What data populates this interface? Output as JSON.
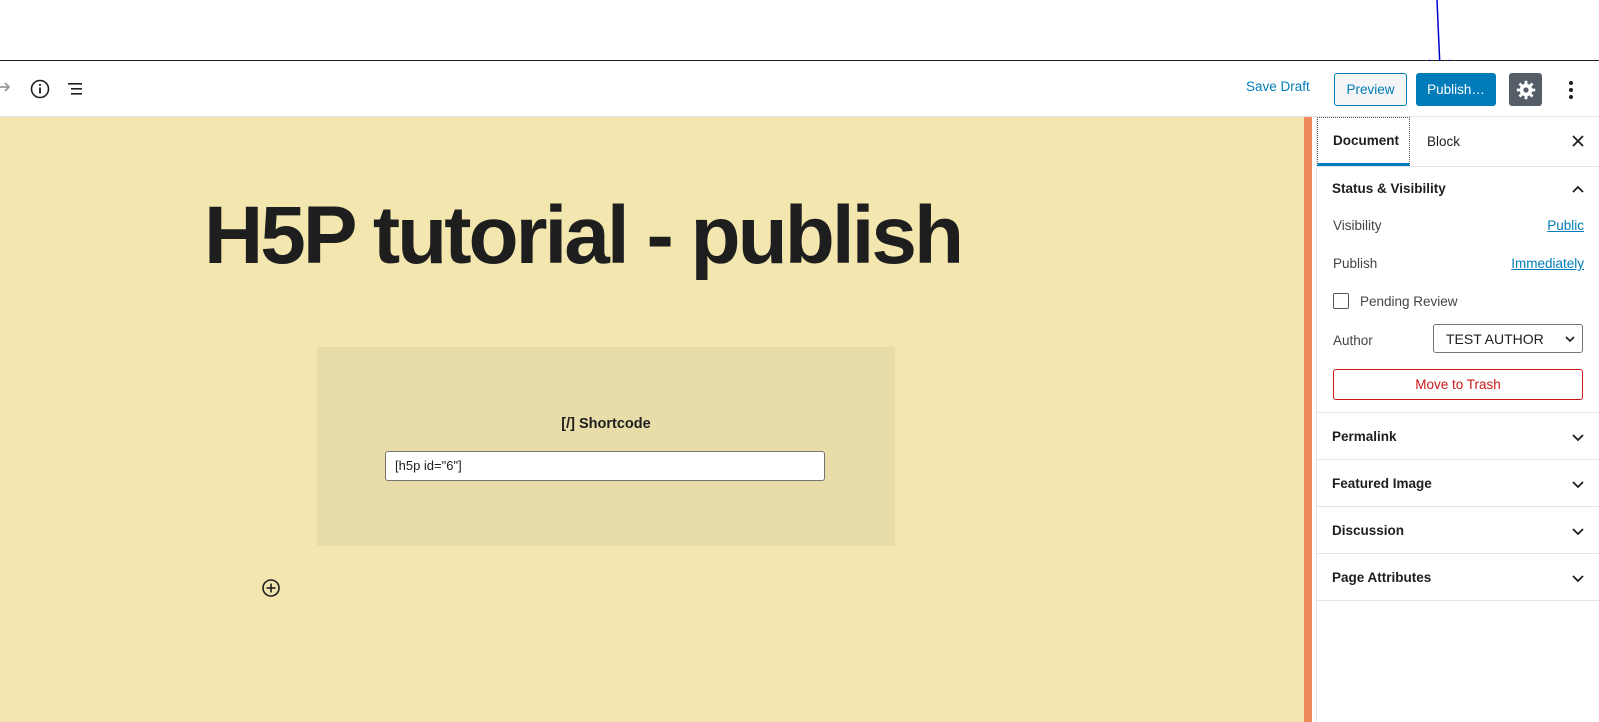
{
  "toolbar": {
    "save_draft": "Save Draft",
    "preview": "Preview",
    "publish": "Publish…",
    "icons": [
      "redo-icon",
      "info-icon",
      "list-view-icon",
      "gear-icon",
      "more-vertical-icon"
    ]
  },
  "editor": {
    "title": "H5P tutorial - publish",
    "shortcode_label": "[/]  Shortcode",
    "shortcode_value": "[h5p id=\"6\"]"
  },
  "sidebar": {
    "tabs": [
      "Document",
      "Block"
    ],
    "status_panel": {
      "title": "Status & Visibility",
      "visibility_label": "Visibility",
      "visibility_value": "Public",
      "publish_label": "Publish",
      "publish_value": "Immediately",
      "pending_review": "Pending Review",
      "author_label": "Author",
      "author_value": "TEST AUTHOR",
      "trash": "Move to Trash"
    },
    "panels": [
      "Permalink",
      "Featured Image",
      "Discussion",
      "Page Attributes"
    ]
  },
  "colors": {
    "accent": "#007cba",
    "canvas": "#f3e6af",
    "danger": "#cc1818"
  }
}
